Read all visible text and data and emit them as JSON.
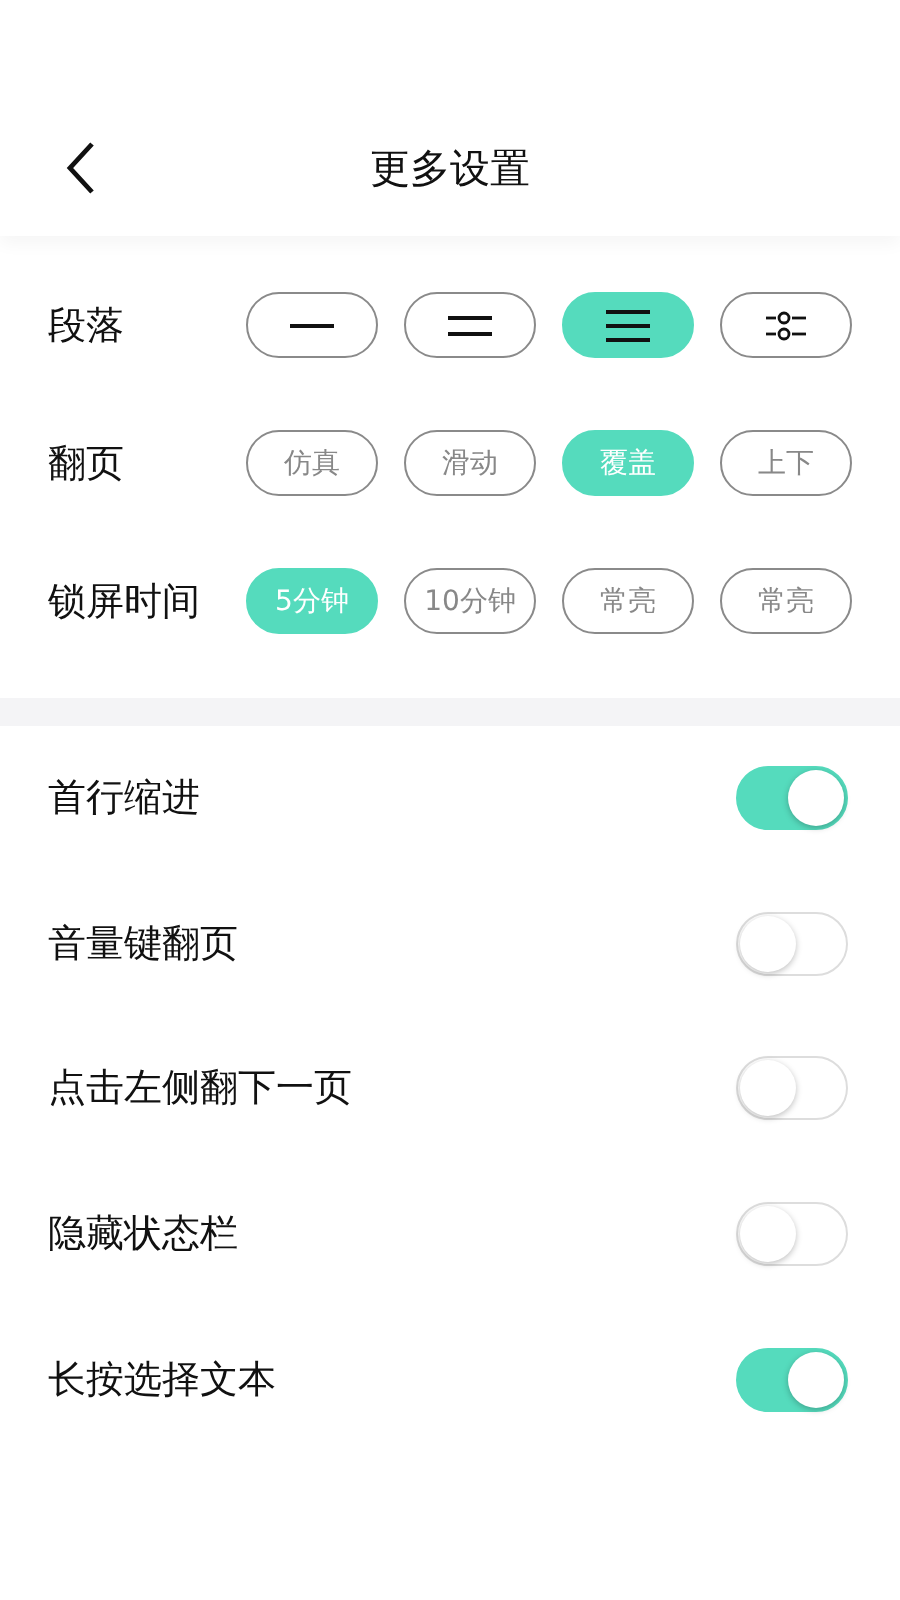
{
  "header": {
    "title": "更多设置"
  },
  "option_rows": [
    {
      "label": "段落",
      "options": [
        {
          "kind": "single",
          "selected": false
        },
        {
          "kind": "double",
          "selected": false
        },
        {
          "kind": "triple",
          "selected": true
        },
        {
          "kind": "custom",
          "selected": false
        }
      ]
    },
    {
      "label": "翻页",
      "options": [
        {
          "text": "仿真",
          "selected": false
        },
        {
          "text": "滑动",
          "selected": false
        },
        {
          "text": "覆盖",
          "selected": true
        },
        {
          "text": "上下",
          "selected": false
        }
      ]
    },
    {
      "label": "锁屏时间",
      "options": [
        {
          "text": "5分钟",
          "selected": true
        },
        {
          "text": "10分钟",
          "selected": false
        },
        {
          "text": "常亮",
          "selected": false
        },
        {
          "text": "常亮",
          "selected": false
        }
      ]
    }
  ],
  "switches": [
    {
      "label": "首行缩进",
      "on": true
    },
    {
      "label": "音量键翻页",
      "on": false
    },
    {
      "label": "点击左侧翻下一页",
      "on": false
    },
    {
      "label": "隐藏状态栏",
      "on": false
    },
    {
      "label": "长按选择文本",
      "on": true
    }
  ]
}
